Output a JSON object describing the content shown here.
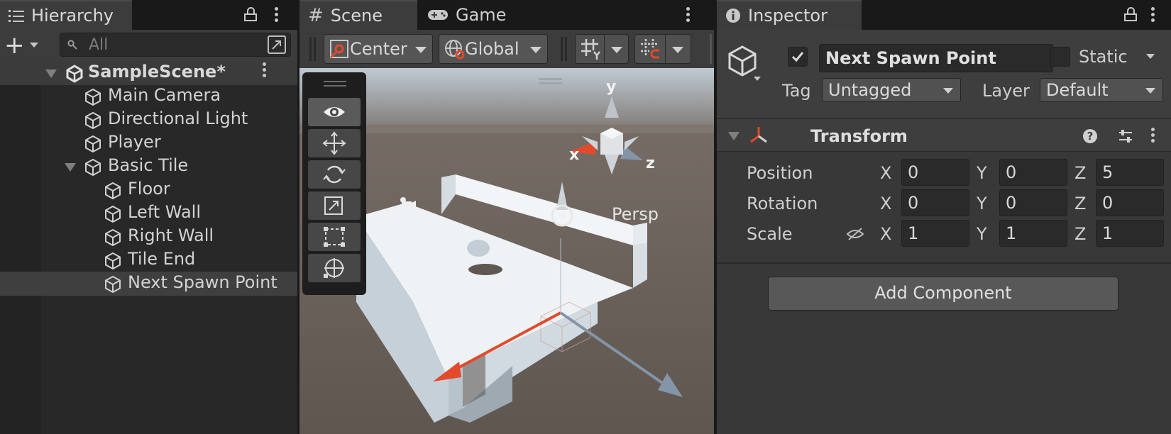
{
  "hierarchy": {
    "tab_label": "Hierarchy",
    "search_placeholder": "All",
    "scene_name": "SampleScene*",
    "items": [
      {
        "label": "Main Camera"
      },
      {
        "label": "Directional Light"
      },
      {
        "label": "Player"
      },
      {
        "label": "Basic Tile"
      },
      {
        "label": "Floor"
      },
      {
        "label": "Left Wall"
      },
      {
        "label": "Right Wall"
      },
      {
        "label": "Tile End"
      },
      {
        "label": "Next Spawn Point"
      }
    ]
  },
  "scene": {
    "tabs": [
      {
        "label": "Scene"
      },
      {
        "label": "Game"
      }
    ],
    "pivot_mode": "Center",
    "pivot_rotation": "Global",
    "gizmo_labels": {
      "x": "x",
      "y": "y",
      "z": "z",
      "projection": "Persp"
    }
  },
  "inspector": {
    "tab_label": "Inspector",
    "object_name": "Next Spawn Point",
    "active": true,
    "static_label": "Static",
    "tag_label": "Tag",
    "tag_value": "Untagged",
    "layer_label": "Layer",
    "layer_value": "Default",
    "transform": {
      "title": "Transform",
      "rows": [
        {
          "label": "Position",
          "x": "0",
          "y": "0",
          "z": "5"
        },
        {
          "label": "Rotation",
          "x": "0",
          "y": "0",
          "z": "0"
        },
        {
          "label": "Scale",
          "x": "1",
          "y": "1",
          "z": "1"
        }
      ],
      "axis_labels": {
        "x": "X",
        "y": "Y",
        "z": "Z"
      }
    },
    "add_component_label": "Add Component"
  },
  "colors": {
    "x_axis": "#e24a2b",
    "y_axis": "#9aa3ad",
    "z_axis": "#8595a8",
    "sky_top": "#c9d3dc",
    "ground": "#6e635c"
  }
}
